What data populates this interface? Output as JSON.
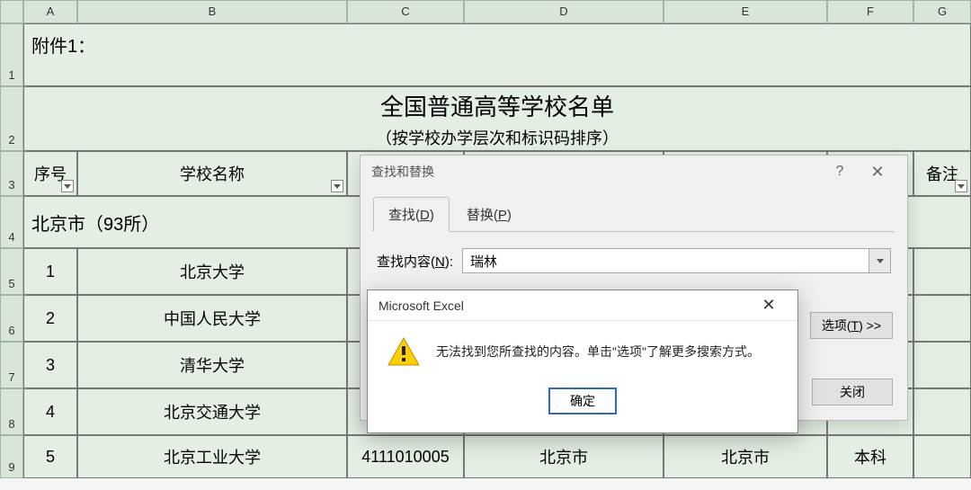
{
  "columns": [
    "A",
    "B",
    "C",
    "D",
    "E",
    "F",
    "G"
  ],
  "rows": [
    "1",
    "2",
    "3",
    "4",
    "5",
    "6",
    "7",
    "8",
    "9"
  ],
  "sheet": {
    "attachment": "附件1：",
    "title_main": "全国普通高等学校名单",
    "title_sub": "（按学校办学层次和标识码排序）",
    "headers": {
      "seq": "序号",
      "name": "学校名称",
      "remark_partial": "备注"
    },
    "section": "北京市（93所）",
    "data_rows": [
      {
        "seq": "1",
        "name": "北京大学"
      },
      {
        "seq": "2",
        "name": "中国人民大学"
      },
      {
        "seq": "3",
        "name": "清华大学"
      },
      {
        "seq": "4",
        "name": "北京交通大学"
      },
      {
        "seq": "5",
        "name": "北京工业大学",
        "code": "4111010005",
        "d": "北京市",
        "e": "北京市",
        "f": "本科"
      }
    ]
  },
  "find_dialog": {
    "title": "查找和替换",
    "tab_find": "查找(D)",
    "tab_replace": "替换(P)",
    "find_label": "查找内容(N):",
    "find_value": "瑞林",
    "options_btn": "选项(T) >>",
    "close_btn": "关闭"
  },
  "alert": {
    "title": "Microsoft Excel",
    "message": "无法找到您所查找的内容。单击\"选项\"了解更多搜索方式。",
    "ok": "确定"
  }
}
